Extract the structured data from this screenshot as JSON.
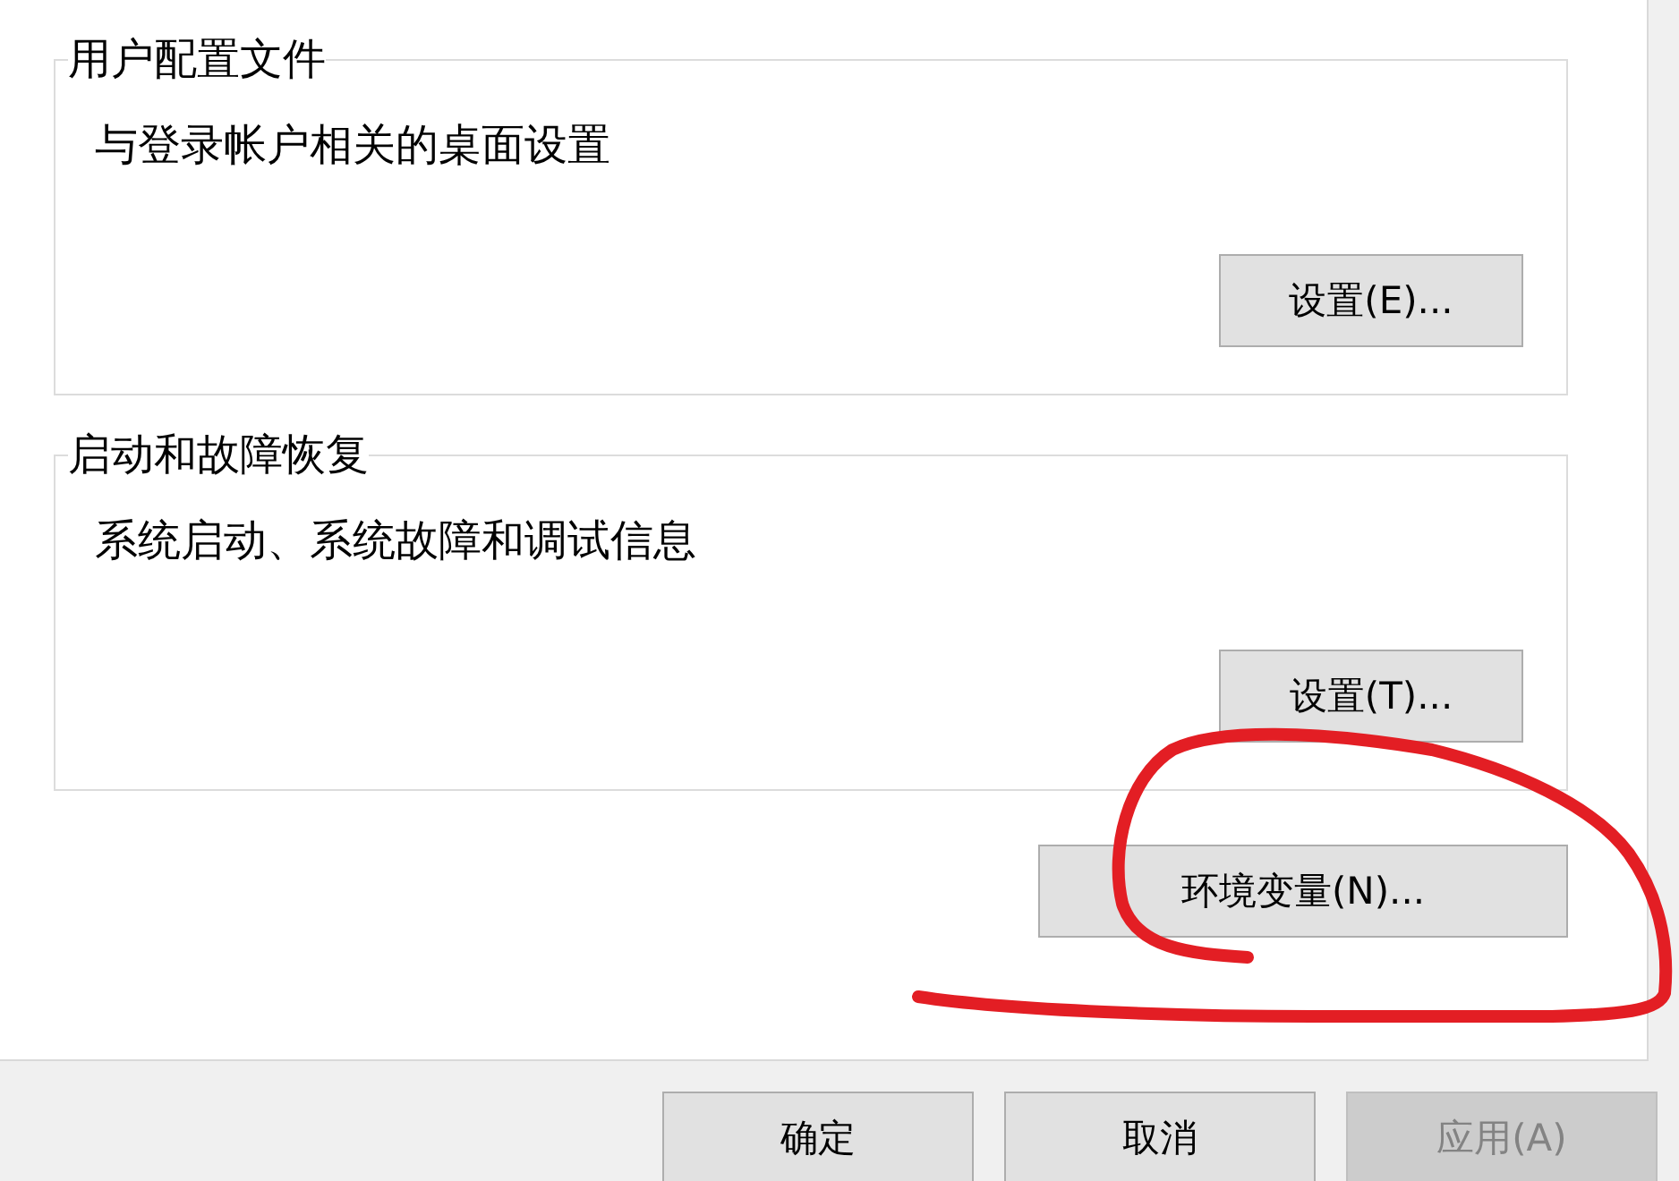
{
  "groups": [
    {
      "title": "用户配置文件",
      "description": "与登录帐户相关的桌面设置",
      "button": "设置(E)..."
    },
    {
      "title": "启动和故障恢复",
      "description": "系统启动、系统故障和调试信息",
      "button": "设置(T)..."
    }
  ],
  "environment_button": "环境变量(N)...",
  "dialog_buttons": [
    {
      "label": "确定",
      "disabled": false
    },
    {
      "label": "取消",
      "disabled": false
    },
    {
      "label": "应用(A)",
      "disabled": true
    }
  ],
  "annotation": {
    "kind": "loop"
  }
}
